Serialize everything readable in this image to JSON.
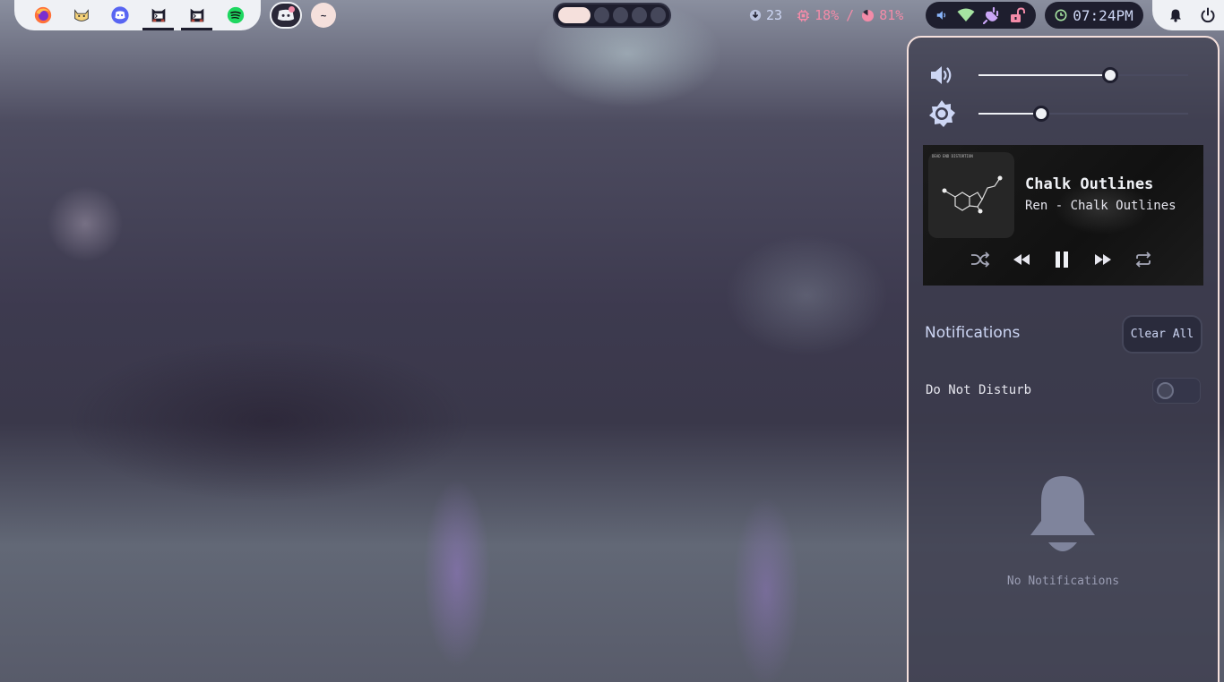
{
  "topbar": {
    "apps": [
      {
        "name": "firefox",
        "icon": "firefox-icon",
        "active": false
      },
      {
        "name": "cat-app",
        "icon": "cat-icon",
        "active": false
      },
      {
        "name": "discord",
        "icon": "discord-icon",
        "active": false
      },
      {
        "name": "terminal-1",
        "icon": "terminal-cat-icon",
        "active": true
      },
      {
        "name": "terminal-2",
        "icon": "terminal-cat-icon",
        "active": true
      },
      {
        "name": "spotify",
        "icon": "spotify-icon",
        "active": false
      }
    ],
    "tray": {
      "tilde_label": "~"
    },
    "workspaces": {
      "count": 5,
      "active_index": 0
    },
    "stats": {
      "updates": "23",
      "cpu": "18%",
      "separator": "/",
      "memory": "81%"
    },
    "clock": "07:24PM"
  },
  "control_center": {
    "volume_level": 0.63,
    "brightness_level": 0.3,
    "player": {
      "title": "Chalk Outlines",
      "subtitle": "Ren - Chalk Outlines",
      "album_text": "DEAD END DISTORTION"
    },
    "notifications": {
      "heading": "Notifications",
      "clear_label": "Clear All",
      "dnd_label": "Do Not Disturb",
      "dnd_enabled": false,
      "empty_text": "No Notifications"
    }
  },
  "colors": {
    "accent": "#f5e0dc",
    "cpu_mem": "#f38ba8",
    "bar_bg": "#1e1e2e",
    "panel_border": "#f5e0dc"
  }
}
